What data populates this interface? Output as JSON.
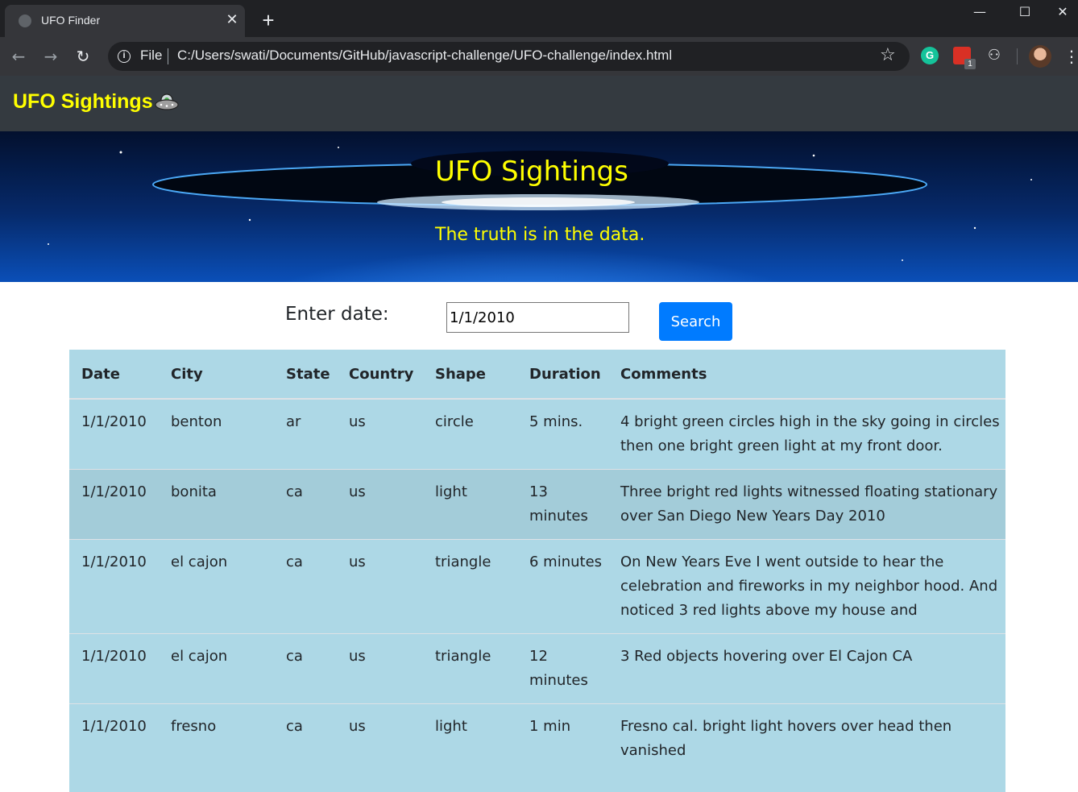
{
  "browser": {
    "tab_title": "UFO Finder",
    "tab_close": "✕",
    "new_tab": "+",
    "window_controls": {
      "minimize": "—",
      "maximize": "☐",
      "close": "✕"
    },
    "omnibox_scheme": "File",
    "omnibox_url": "C:/Users/swati/Documents/GitHub/javascript-challenge/UFO-challenge/index.html",
    "extension_badge": "1"
  },
  "navbar": {
    "brand": "UFO Sightings"
  },
  "hero": {
    "title": "UFO Sightings",
    "subtitle": "The truth is in the data."
  },
  "filter": {
    "label": "Enter date:",
    "value": "1/1/2010",
    "button": "Search"
  },
  "table": {
    "headers": [
      "Date",
      "City",
      "State",
      "Country",
      "Shape",
      "Duration",
      "Comments"
    ],
    "rows": [
      [
        "1/1/2010",
        "benton",
        "ar",
        "us",
        "circle",
        "5 mins.",
        "4 bright green circles high in the sky going in circles then one bright green light at my front door."
      ],
      [
        "1/1/2010",
        "bonita",
        "ca",
        "us",
        "light",
        "13 minutes",
        "Three bright red lights witnessed floating stationary over San Diego New Years Day 2010"
      ],
      [
        "1/1/2010",
        "el cajon",
        "ca",
        "us",
        "triangle",
        "6 minutes",
        "On New Years Eve I went outside to hear the celebration and fireworks in my neighbor hood. And noticed 3 red lights above my house and"
      ],
      [
        "1/1/2010",
        "el cajon",
        "ca",
        "us",
        "triangle",
        "12 minutes",
        "3 Red objects hovering over El Cajon CA"
      ],
      [
        "1/1/2010",
        "fresno",
        "ca",
        "us",
        "light",
        "1 min",
        "Fresno cal. bright light hovers over head then vanished"
      ]
    ]
  }
}
